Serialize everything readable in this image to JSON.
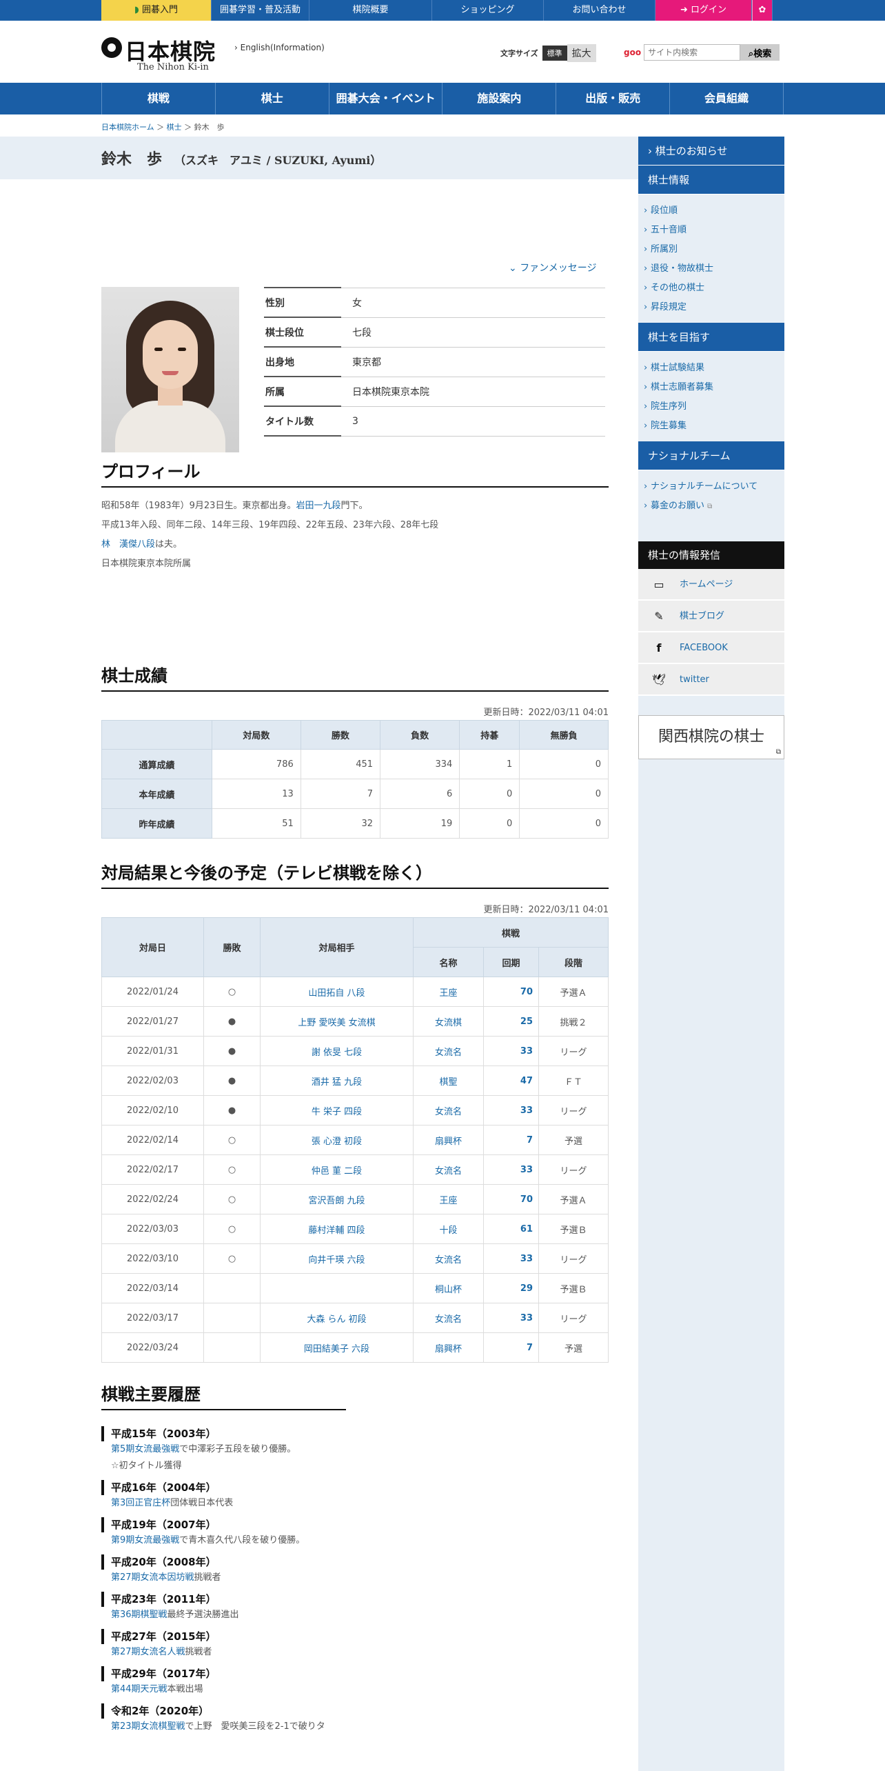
{
  "topbar": {
    "items": [
      "囲碁入門",
      "囲碁学習・普及活動",
      "棋院概要",
      "ショッピング",
      "お問い合わせ",
      "ログイン"
    ]
  },
  "header": {
    "logo_jp": "日本棋院",
    "logo_en": "The Nihon Ki-in",
    "english_link": "English(Information)",
    "fontsize_label": "文字サイズ",
    "fontsize_standard": "標準",
    "fontsize_large": "拡大",
    "search_brand": "goo",
    "search_placeholder": "サイト内検索",
    "search_button": "検索"
  },
  "mainnav": [
    "棋戦",
    "棋士",
    "囲碁大会・イベント",
    "施設案内",
    "出版・販売",
    "会員組織"
  ],
  "breadcrumb": [
    "日本棋院ホーム",
    "棋士",
    "鈴木　歩"
  ],
  "player": {
    "name": "鈴木　歩",
    "kana": "（スズキ　アユミ / SUZUKI, Ayumi）",
    "fan_message": "ファンメッセージ",
    "info": [
      {
        "label": "性別",
        "value": "女"
      },
      {
        "label": "棋士段位",
        "value": "七段"
      },
      {
        "label": "出身地",
        "value": "東京都"
      },
      {
        "label": "所属",
        "value": "日本棋院東京本院"
      },
      {
        "label": "タイトル数",
        "value": "3"
      }
    ]
  },
  "profile": {
    "heading": "プロフィール",
    "line1_pre": "昭和58年（1983年）9月23日生。東京都出身。",
    "line1_link": "岩田一九段",
    "line1_post": "門下。",
    "line2": "平成13年入段、同年二段、14年三段、19年四段、22年五段、23年六段、28年七段",
    "line3_link": "林　漢傑八段",
    "line3_post": "は夫。",
    "line4": "日本棋院東京本院所属"
  },
  "stats": {
    "heading": "棋士成績",
    "updated": "更新日時：2022/03/11 04:01",
    "columns": [
      "対局数",
      "勝数",
      "負数",
      "持碁",
      "無勝負"
    ],
    "rows": [
      {
        "label": "通算成績",
        "values": [
          "786",
          "451",
          "334",
          "1",
          "0"
        ]
      },
      {
        "label": "本年成績",
        "values": [
          "13",
          "7",
          "6",
          "0",
          "0"
        ]
      },
      {
        "label": "昨年成績",
        "values": [
          "51",
          "32",
          "19",
          "0",
          "0"
        ]
      }
    ]
  },
  "games": {
    "heading": "対局結果と今後の予定（テレビ棋戦を除く）",
    "updated": "更新日時：2022/03/11 04:01",
    "col_date": "対局日",
    "col_result": "勝敗",
    "col_opponent": "対局相手",
    "col_kisen": "棋戦",
    "col_name": "名称",
    "col_kai": "回期",
    "col_stage": "段階",
    "rows": [
      {
        "date": "2022/01/24",
        "result": "○",
        "opponent": "山田拓自 八段",
        "kisen": "王座",
        "kai": "70",
        "stage": "予選Ａ"
      },
      {
        "date": "2022/01/27",
        "result": "●",
        "opponent": "上野 愛咲美 女流棋",
        "kisen": "女流棋",
        "kai": "25",
        "stage": "挑戦２"
      },
      {
        "date": "2022/01/31",
        "result": "●",
        "opponent": "謝 依旻 七段",
        "kisen": "女流名",
        "kai": "33",
        "stage": "リーグ"
      },
      {
        "date": "2022/02/03",
        "result": "●",
        "opponent": "酒井 猛 九段",
        "kisen": "棋聖",
        "kai": "47",
        "stage": "ＦＴ"
      },
      {
        "date": "2022/02/10",
        "result": "●",
        "opponent": "牛 栄子 四段",
        "kisen": "女流名",
        "kai": "33",
        "stage": "リーグ"
      },
      {
        "date": "2022/02/14",
        "result": "○",
        "opponent": "張 心澄 初段",
        "kisen": "扇興杯",
        "kai": "7",
        "stage": "予選"
      },
      {
        "date": "2022/02/17",
        "result": "○",
        "opponent": "仲邑 菫 二段",
        "kisen": "女流名",
        "kai": "33",
        "stage": "リーグ"
      },
      {
        "date": "2022/02/24",
        "result": "○",
        "opponent": "宮沢吾朗 九段",
        "kisen": "王座",
        "kai": "70",
        "stage": "予選Ａ"
      },
      {
        "date": "2022/03/03",
        "result": "○",
        "opponent": "藤村洋輔 四段",
        "kisen": "十段",
        "kai": "61",
        "stage": "予選Ｂ"
      },
      {
        "date": "2022/03/10",
        "result": "○",
        "opponent": "向井千瑛 六段",
        "kisen": "女流名",
        "kai": "33",
        "stage": "リーグ"
      },
      {
        "date": "2022/03/14",
        "result": "",
        "opponent": "",
        "kisen": "桐山杯",
        "kai": "29",
        "stage": "予選Ｂ"
      },
      {
        "date": "2022/03/17",
        "result": "",
        "opponent": "大森 らん 初段",
        "kisen": "女流名",
        "kai": "33",
        "stage": "リーグ"
      },
      {
        "date": "2022/03/24",
        "result": "",
        "opponent": "岡田結美子 六段",
        "kisen": "扇興杯",
        "kai": "7",
        "stage": "予選"
      }
    ]
  },
  "history": {
    "heading": "棋戦主要履歴",
    "entries": [
      {
        "year": "平成15年（2003年）",
        "lines": [
          {
            "link": "第5期女流最強戦",
            "text": "で中澤彩子五段を破り優勝。"
          },
          {
            "link": "",
            "text": "☆初タイトル獲得"
          }
        ]
      },
      {
        "year": "平成16年（2004年）",
        "lines": [
          {
            "link": "第3回正官庄杯",
            "text": "団体戦日本代表"
          }
        ]
      },
      {
        "year": "平成19年（2007年）",
        "lines": [
          {
            "link": "第9期女流最強戦",
            "text": "で青木喜久代八段を破り優勝。"
          }
        ]
      },
      {
        "year": "平成20年（2008年）",
        "lines": [
          {
            "link": "第27期女流本因坊戦",
            "text": "挑戦者"
          }
        ]
      },
      {
        "year": "平成23年（2011年）",
        "lines": [
          {
            "link": "第36期棋聖戦",
            "text": "最終予選決勝進出"
          }
        ]
      },
      {
        "year": "平成27年（2015年）",
        "lines": [
          {
            "link": "第27期女流名人戦",
            "text": "挑戦者"
          }
        ]
      },
      {
        "year": "平成29年（2017年）",
        "lines": [
          {
            "link": "第44期天元戦",
            "text": "本戦出場"
          }
        ]
      },
      {
        "year": "令和2年（2020年）",
        "lines": [
          {
            "link": "第23期女流棋聖戦",
            "text": "で上野　愛咲美三段を2-1で破りタ"
          }
        ]
      }
    ]
  },
  "sidebar": {
    "news": "棋士のお知らせ",
    "info_heading": "棋士情報",
    "info_items": [
      "段位順",
      "五十音順",
      "所属別",
      "退役・物故棋士",
      "その他の棋士",
      "昇段規定"
    ],
    "aim_heading": "棋士を目指す",
    "aim_items": [
      "棋士試験結果",
      "棋士志願者募集",
      "院生序列",
      "院生募集"
    ],
    "national_heading": "ナショナルチーム",
    "national_items": [
      "ナショナルチームについて",
      "募金のお願い"
    ],
    "sns_heading": "棋士の情報発信",
    "sns_items": [
      {
        "icon": "monitor-icon",
        "label": "ホームページ"
      },
      {
        "icon": "pencil-icon",
        "label": "棋士ブログ"
      },
      {
        "icon": "facebook-icon",
        "label": "FACEBOOK"
      },
      {
        "icon": "twitter-icon",
        "label": "twitter"
      }
    ],
    "kansai": "関西棋院の棋士"
  }
}
